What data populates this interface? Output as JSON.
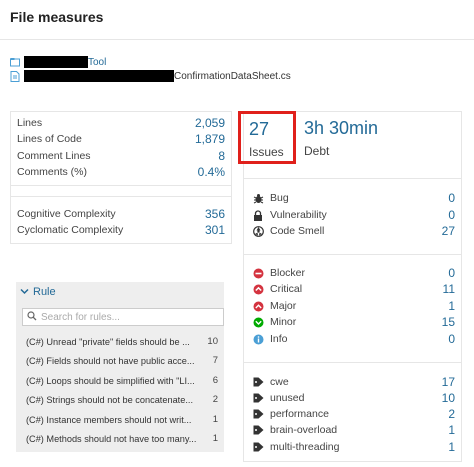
{
  "header": {
    "title": "File measures"
  },
  "path": {
    "project_suffix": "Tool",
    "file_suffix": "ConfirmationDataSheet.cs"
  },
  "size_metrics": [
    {
      "label": "Lines",
      "value": "2,059"
    },
    {
      "label": "Lines of Code",
      "value": "1,879"
    },
    {
      "label": "Comment Lines",
      "value": "8"
    },
    {
      "label": "Comments (%)",
      "value": "0.4%"
    }
  ],
  "complexity_metrics": [
    {
      "label": "Cognitive Complexity",
      "value": "356"
    },
    {
      "label": "Cyclomatic Complexity",
      "value": "301"
    }
  ],
  "issues": {
    "count": "27",
    "label": "Issues",
    "highlight_color": "#e0201b"
  },
  "debt": {
    "value": "3h 30min",
    "label": "Debt"
  },
  "types": [
    {
      "icon": "bug-icon",
      "label": "Bug",
      "value": "0"
    },
    {
      "icon": "lock-icon",
      "label": "Vulnerability",
      "value": "0"
    },
    {
      "icon": "code-smell-icon",
      "label": "Code Smell",
      "value": "27"
    }
  ],
  "severities": [
    {
      "icon": "blocker-icon",
      "label": "Blocker",
      "value": "0",
      "color": "#d4333f"
    },
    {
      "icon": "critical-icon",
      "label": "Critical",
      "value": "11",
      "color": "#d4333f"
    },
    {
      "icon": "major-icon",
      "label": "Major",
      "value": "1",
      "color": "#d4333f"
    },
    {
      "icon": "minor-icon",
      "label": "Minor",
      "value": "15",
      "color": "#00aa00"
    },
    {
      "icon": "info-icon",
      "label": "Info",
      "value": "0",
      "color": "#4b9fd5"
    }
  ],
  "tags": [
    {
      "label": "cwe",
      "value": "17"
    },
    {
      "label": "unused",
      "value": "10"
    },
    {
      "label": "performance",
      "value": "2"
    },
    {
      "label": "brain-overload",
      "value": "1"
    },
    {
      "label": "multi-threading",
      "value": "1"
    }
  ],
  "rule_facet": {
    "title": "Rule",
    "search_placeholder": "Search for rules...",
    "items": [
      {
        "label": "(C#) Unread \"private\" fields should be ...",
        "value": "10"
      },
      {
        "label": "(C#) Fields should not have public acce...",
        "value": "7"
      },
      {
        "label": "(C#) Loops should be simplified with \"LI...",
        "value": "6"
      },
      {
        "label": "(C#) Strings should not be concatenate...",
        "value": "2"
      },
      {
        "label": "(C#) Instance members should not writ...",
        "value": "1"
      },
      {
        "label": "(C#) Methods should not have too many...",
        "value": "1"
      }
    ]
  },
  "colors": {
    "link": "#236a97",
    "border": "#e6e6e6"
  }
}
